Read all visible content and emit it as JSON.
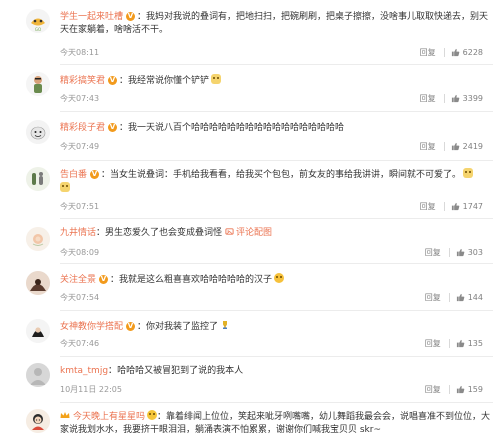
{
  "comments": [
    {
      "username": "学生一起来吐槽",
      "text": "我妈对我说的叠词有，把地扫扫，把碗刷刷，把桌子擦擦，没啥事儿取取快递去，别天天在家躺着，啥啥活不干。",
      "time": "今天08:11",
      "reply_label": "回复",
      "likes": "6228"
    },
    {
      "username": "精彩搞笑君",
      "text": "我经常说你懂个铲铲",
      "time": "今天07:43",
      "reply_label": "回复",
      "likes": "3399"
    },
    {
      "username": "精彩段子君",
      "text": "我一天说八百个哈哈哈哈哈哈哈哈哈哈哈哈哈哈哈哈哈",
      "time": "今天07:49",
      "reply_label": "回复",
      "likes": "2419"
    },
    {
      "username": "告白番",
      "text": "当女生说叠词：手机给我看看，给我买个包包，前女友的事给我讲讲，瞬间就不可爱了。",
      "time": "今天07:51",
      "reply_label": "回复",
      "likes": "1747"
    },
    {
      "username": "九井情话",
      "text": "男生恋爱久了也会变成叠词怪",
      "link_label": "评论配图",
      "time": "今天08:09",
      "reply_label": "回复",
      "likes": "303"
    },
    {
      "username": "关注全景",
      "text": "我就是这么粗喜喜欢哈哈哈哈哈的汉子",
      "time": "今天07:54",
      "reply_label": "回复",
      "likes": "144"
    },
    {
      "username": "女神教你学搭配",
      "text": "你对我装了监控了",
      "time": "今天07:46",
      "reply_label": "回复",
      "likes": "135"
    },
    {
      "username": "kmta_tmjg",
      "text": "哈哈哈又被冒犯到了说的我本人",
      "time": "10月11日 22:05",
      "reply_label": "回复",
      "likes": "159"
    },
    {
      "username": "今天晚上有星星吗",
      "text": "靠着绯闻上位位，笑起来呲牙咧嘴嘴，幼儿舞蹈我最会会，说唱喜准不到位位，大家说我划水水，我要挤干眼泪泪，躺涌表演不怕累累，谢谢你们喊我宝贝贝 skr~",
      "time": "",
      "reply_label": "",
      "likes": ""
    }
  ]
}
